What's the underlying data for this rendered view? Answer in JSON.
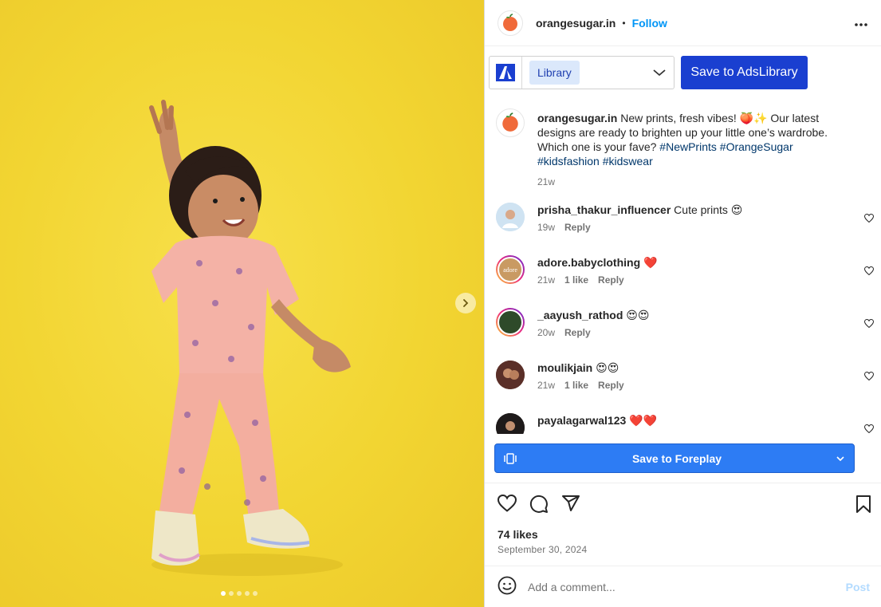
{
  "post": {
    "username": "orangesugar.in",
    "separator": "•",
    "follow_label": "Follow",
    "caption_text": "New prints, fresh vibes! 🍑✨ Our latest designs are ready to brighten up your little one’s wardrobe. Which one is your fave?",
    "hashtags": [
      "#NewPrints",
      "#OrangeSugar",
      "#kidsfashion",
      "#kidswear"
    ],
    "caption_time": "21w",
    "likes": "74 likes",
    "date": "September 30, 2024",
    "media_index": 1,
    "media_count": 5
  },
  "adslibrary": {
    "select_value": "Library",
    "save_label": "Save to AdsLibrary"
  },
  "foreplay": {
    "save_label": "Save to Foreplay"
  },
  "comments": [
    {
      "user": "prisha_thakur_influencer",
      "text": "Cute prints 😍",
      "time": "19w",
      "likes": "",
      "reply": "Reply"
    },
    {
      "user": "adore.babyclothing",
      "text": "❤️",
      "time": "21w",
      "likes": "1 like",
      "reply": "Reply",
      "avatar_text": "adore"
    },
    {
      "user": "_aayush_rathod",
      "text": "😍😍",
      "time": "20w",
      "likes": "",
      "reply": "Reply"
    },
    {
      "user": "moulikjain",
      "text": "😍😍",
      "time": "21w",
      "likes": "1 like",
      "reply": "Reply"
    },
    {
      "user": "payalagarwal123",
      "text": "❤️❤️",
      "time": "",
      "likes": "",
      "reply": ""
    }
  ],
  "composer": {
    "placeholder": "Add a comment...",
    "post_label": "Post"
  },
  "colors": {
    "accent_blue": "#0095f6",
    "adslibrary_button": "#1a3fd0",
    "foreplay_button": "#2d7cf4",
    "media_background": "#f3d835",
    "brand_orange": "#f06a3a"
  },
  "icons": {
    "more": "more-horizontal-icon",
    "like": "heart-icon",
    "comment": "comment-bubble-icon",
    "share": "paper-plane-icon",
    "save": "bookmark-icon",
    "emoji": "smiley-icon",
    "next": "chevron-right-icon"
  }
}
